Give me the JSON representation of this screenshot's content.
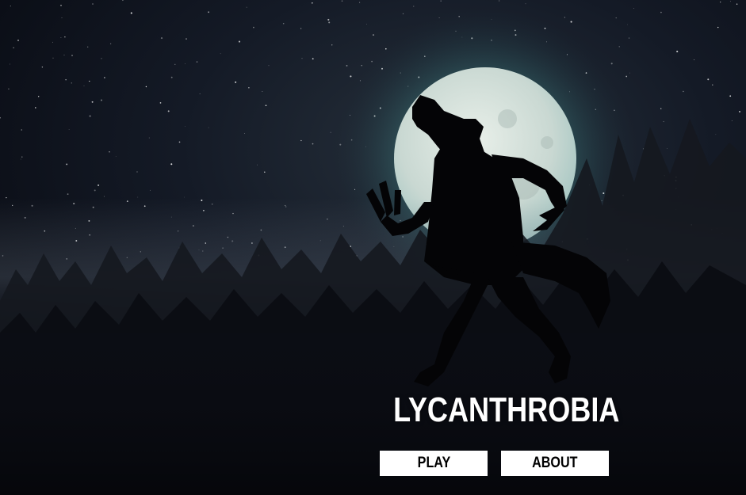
{
  "title": "LYCANTHROBIA",
  "menu": {
    "play_label": "PLAY",
    "about_label": "ABOUT"
  },
  "colors": {
    "sky": "#0e1420",
    "moon": "#d6e4de",
    "moon_glow": "#7fd8d0",
    "silhouette": "#050507",
    "button_bg": "#ffffff",
    "button_text": "#000000",
    "title_text": "#ffffff"
  },
  "scene": {
    "background": "night-forest-full-moon",
    "figure": "werewolf-silhouette-howling"
  }
}
